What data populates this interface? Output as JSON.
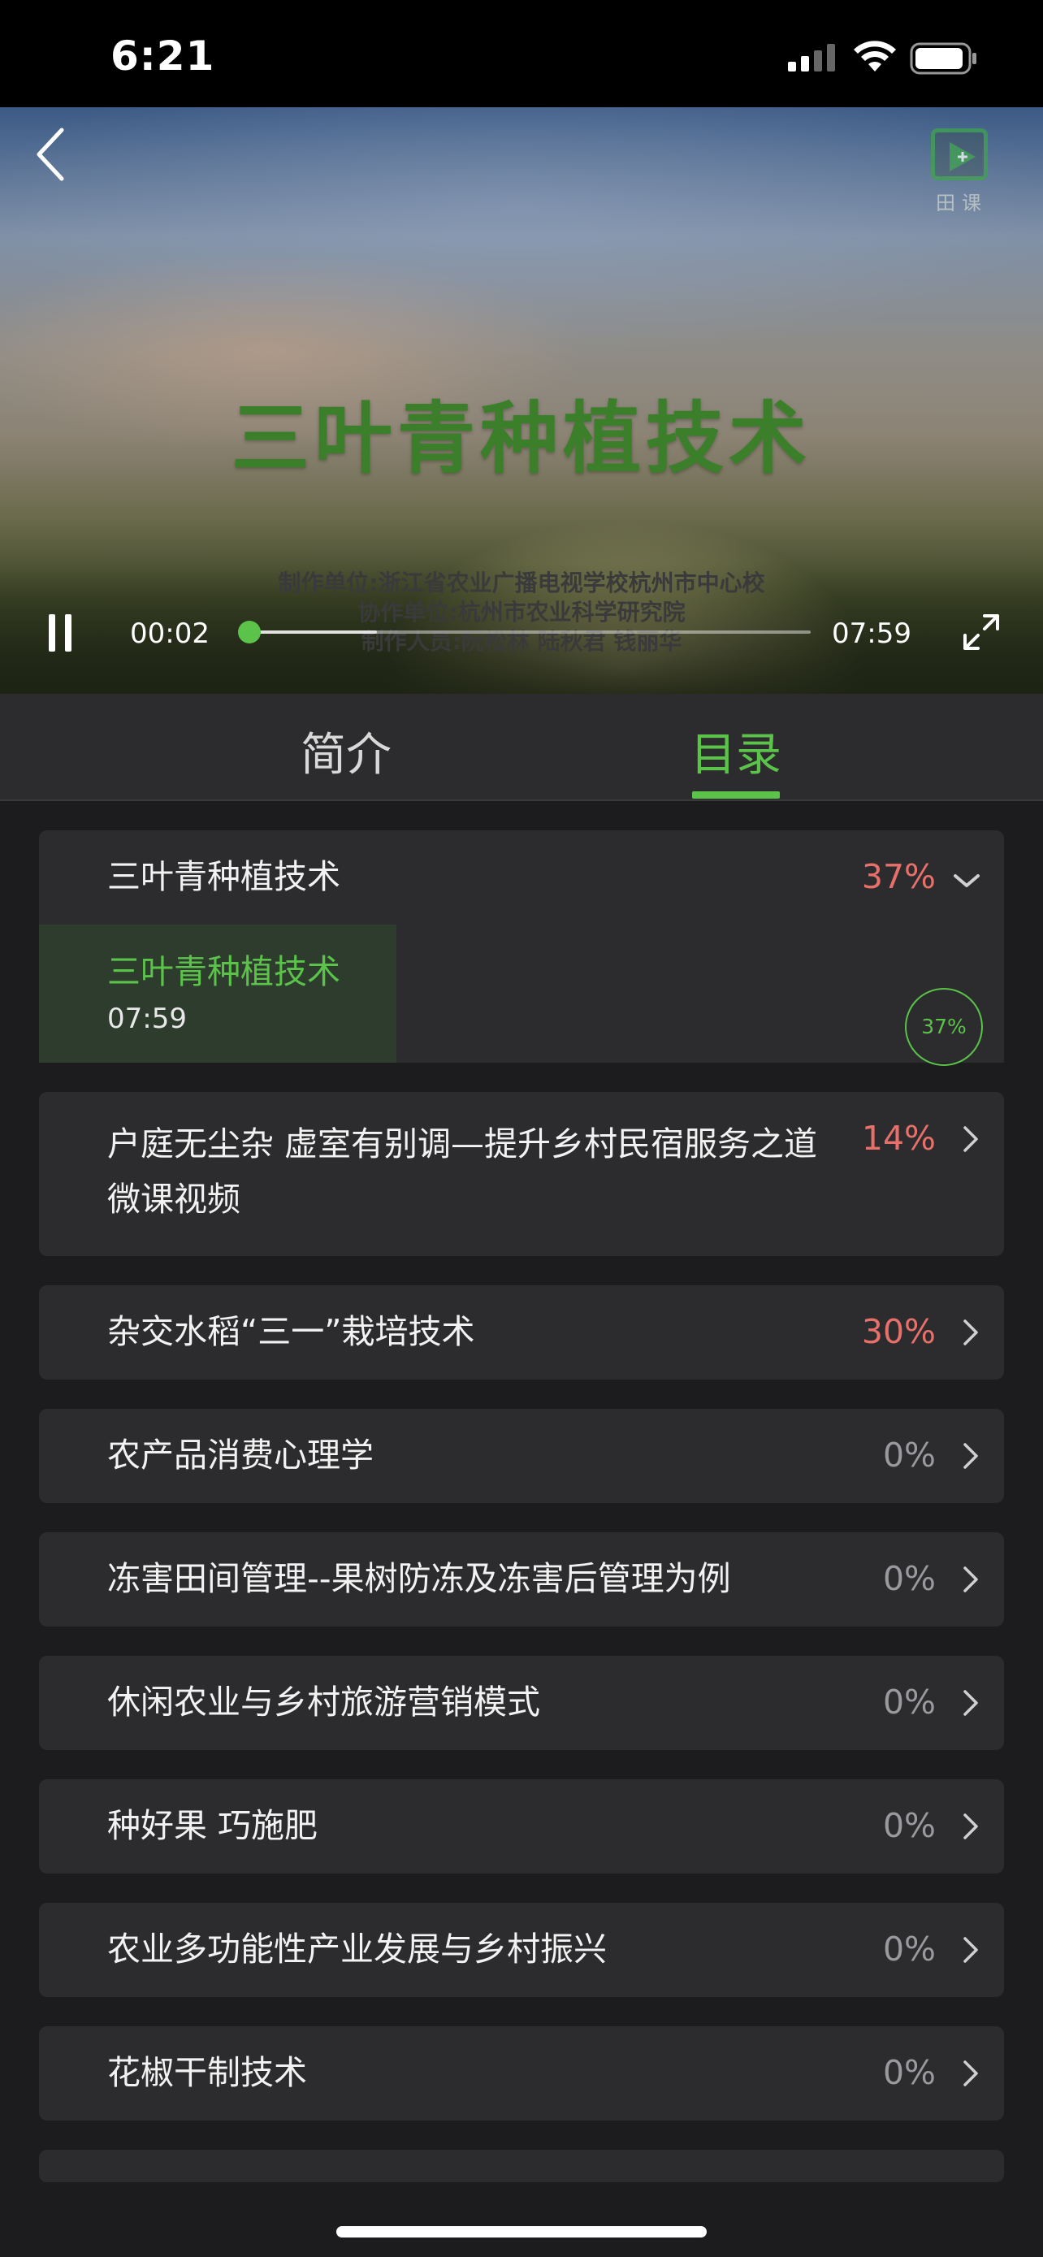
{
  "status_bar": {
    "time": "6:21"
  },
  "player": {
    "video_title": "三叶青种植技术",
    "credits": [
      "制作单位:浙江省农业广播电视学校杭州市中心校",
      "协作单位:杭州市农业科学研究院",
      "制作人员:阮松林   陆秋君   钱丽华"
    ],
    "brand": "田课",
    "current_time": "00:02",
    "total_time": "07:59",
    "played_fraction": 0.004,
    "buffered_fraction": 0.23
  },
  "tabs": [
    {
      "label": "简介",
      "active": false
    },
    {
      "label": "目录",
      "active": true
    }
  ],
  "accent_color": "#5bc24a",
  "progress_color": "#e8706b",
  "catalog": {
    "expanded": {
      "title": "三叶青种植技术",
      "percent": "37%",
      "lesson": {
        "title": "三叶青种植技术",
        "duration": "07:59",
        "progress": "37%"
      }
    },
    "items": [
      {
        "title": "户庭无尘杂 虚室有别调—提升乡村民宿服务之道微课视频",
        "percent": "14%"
      },
      {
        "title": "杂交水稻“三一”栽培技术",
        "percent": "30%"
      },
      {
        "title": "农产品消费心理学",
        "percent": "0%"
      },
      {
        "title": "冻害田间管理--果树防冻及冻害后管理为例",
        "percent": "0%"
      },
      {
        "title": "休闲农业与乡村旅游营销模式",
        "percent": "0%"
      },
      {
        "title": "种好果  巧施肥",
        "percent": "0%"
      },
      {
        "title": "农业多功能性产业发展与乡村振兴",
        "percent": "0%"
      },
      {
        "title": "花椒干制技术",
        "percent": "0%"
      }
    ]
  }
}
